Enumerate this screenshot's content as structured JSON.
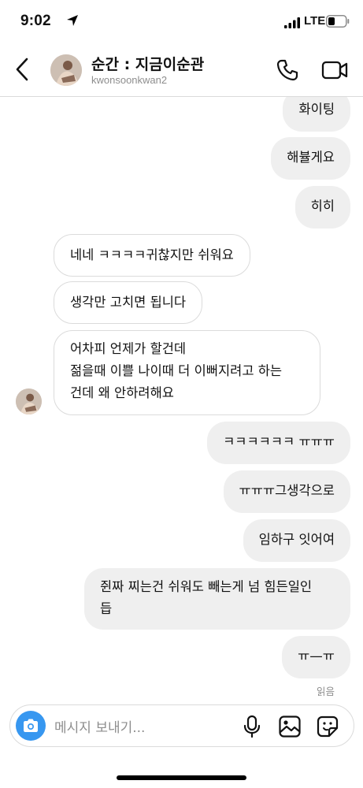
{
  "status_bar": {
    "time": "9:02",
    "network": "LTE"
  },
  "header": {
    "name": "순간 : 지금이순관",
    "username": "kwonsoonkwan2"
  },
  "messages": [
    {
      "from": "me",
      "text": "화이팅"
    },
    {
      "from": "me",
      "text": "해뷸게요"
    },
    {
      "from": "me",
      "text": "히히"
    },
    {
      "from": "them",
      "text": "네네 ㅋㅋㅋㅋ귀찮지만 쉬워요"
    },
    {
      "from": "them",
      "text": "생각만 고치면 됩니다"
    },
    {
      "from": "them",
      "lines": [
        "어차피 언제가 할건데",
        "젊을때 이쁠 나이때 더 이뻐지려고 하는",
        "건데 왜 안하려해요"
      ]
    },
    {
      "from": "me",
      "text": "ㅋㅋㅋㅋㅋㅋ ㅠㅠㅠ"
    },
    {
      "from": "me",
      "text": "ㅠㅠㅠ그생각으로"
    },
    {
      "from": "me",
      "text": "임하구 잇어여"
    },
    {
      "from": "me",
      "lines": [
        "쥔짜 찌는건 쉬워도 빼는게 넘 힘든일인",
        "듭"
      ]
    },
    {
      "from": "me",
      "text": "ㅠ—ㅠ"
    }
  ],
  "seen_label": "읽음",
  "composer": {
    "placeholder": "메시지 보내기..."
  },
  "colors": {
    "accent": "#3797f0",
    "bubble_out": "#efefef",
    "border": "#dbdbdb",
    "muted": "#8e8e8e"
  }
}
